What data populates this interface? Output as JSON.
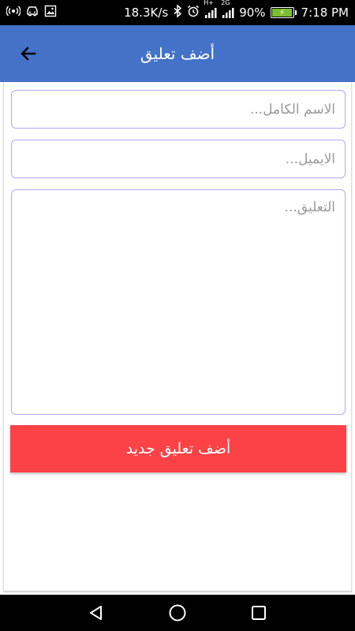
{
  "status_bar": {
    "network_speed": "18.3K/s",
    "signal_label_1": "H+",
    "signal_label_2": "2G",
    "battery": "90%",
    "time": "7:18 PM",
    "battery_level": 0.9,
    "battery_color": "#7cbe2f"
  },
  "toolbar": {
    "title": "أضف تعليق",
    "back_icon": "arrow-back-icon",
    "background": "#4472c8"
  },
  "form": {
    "name_placeholder": "الاسم الكامل...",
    "email_placeholder": "الايميل...",
    "comment_placeholder": "التعليق...",
    "name_value": "",
    "email_value": "",
    "comment_value": "",
    "border_color": "#b3a9f0"
  },
  "submit_button": {
    "label": "أضف تعليق جديد",
    "color": "#fb4246"
  },
  "nav_bar": {
    "back_icon": "triangle-back-icon",
    "home_icon": "circle-home-icon",
    "recents_icon": "square-recents-icon"
  }
}
